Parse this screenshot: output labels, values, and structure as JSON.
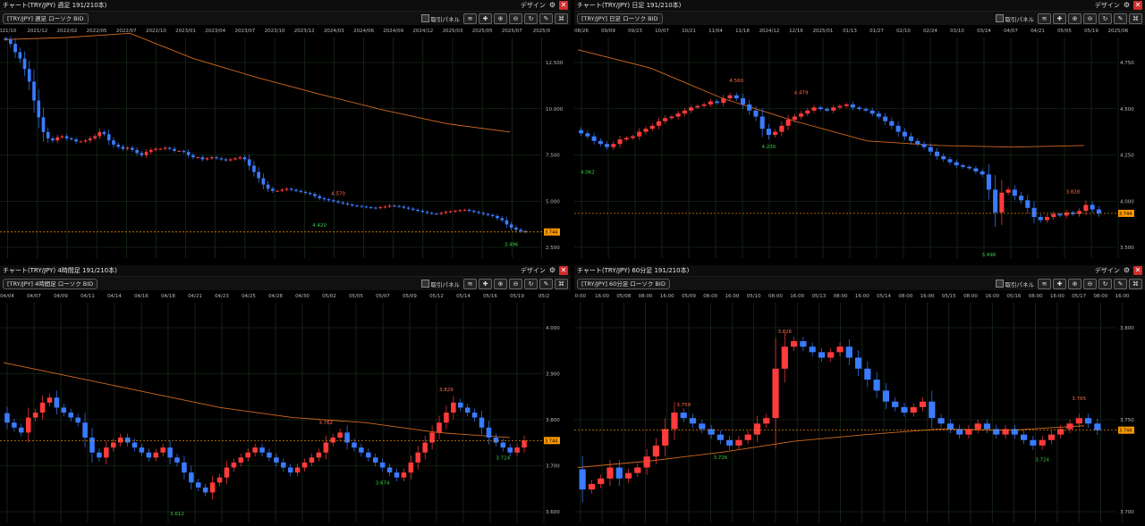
{
  "common": {
    "design_label": "デザイン",
    "trade_panel_label": "取引パネル",
    "symbol_select": "[TRY/JPY] ローソク BID",
    "colors": {
      "up": "#ff3b3b",
      "down": "#3a7bff",
      "ma": "#d2691e",
      "grid": "#1f3a1f",
      "axis": "#bbbbbb",
      "current": "#ff9900"
    }
  },
  "panels": [
    {
      "title": "チャート(TRY/JPY) 週足 191/210本)",
      "symbol": "[TRY/JPY] 週足 ローソク BID",
      "x_ticks": [
        "021/10",
        "2021/12",
        "2022/02",
        "2022/05",
        "2022/07",
        "2022/10",
        "2023/01",
        "2023/04",
        "2023/07",
        "2023/10",
        "2023/12",
        "2024/03",
        "2024/06",
        "2024/09",
        "2024/12",
        "2025/03",
        "2025/05",
        "2025/07",
        "2025/0"
      ],
      "y_ticks": [
        "12.500",
        "10.000",
        "7.500",
        "5.000",
        "2.500"
      ],
      "current_price": "3.744",
      "annotations": [
        "4.420",
        "4.570",
        "3.496"
      ]
    },
    {
      "title": "チャート(TRY/JPY) 日足 191/210本)",
      "symbol": "[TRY/JPY] 日足 ローソク BID",
      "x_ticks": [
        "08/26",
        "09/09",
        "09/23",
        "10/07",
        "10/21",
        "11/04",
        "11/18",
        "2024/12",
        "12/16",
        "2025/01",
        "01/13",
        "01/27",
        "02/10",
        "02/24",
        "03/10",
        "03/24",
        "04/07",
        "04/21",
        "05/05",
        "05/19",
        "2025/06"
      ],
      "y_ticks": [
        "4.750",
        "4.500",
        "4.250",
        "4.000",
        "3.500"
      ],
      "current_price": "3.744",
      "annotations": [
        "4.560",
        "4.479",
        "4.230",
        "4.062",
        "3.496",
        "3.828"
      ]
    },
    {
      "title": "チャート(TRY/JPY) 4時間足 191/210本)",
      "symbol": "[TRY/JPY] 4時間足 ローソク BID",
      "x_ticks": [
        "04/04",
        "04/07",
        "04/09",
        "04/11",
        "04/14",
        "04/16",
        "04/18",
        "04/21",
        "04/23",
        "04/25",
        "04/28",
        "04/30",
        "05/02",
        "05/05",
        "05/07",
        "05/09",
        "05/12",
        "05/14",
        "05/16",
        "05/19",
        "05/2"
      ],
      "y_ticks": [
        "4.000",
        "3.900",
        "3.800",
        "3.700",
        "3.600"
      ],
      "current_price": "3.744",
      "annotations": [
        "3.829",
        "3.762",
        "3.674",
        "3.724",
        "3.612"
      ]
    },
    {
      "title": "チャート(TRY/JPY) 60分足 191/210本)",
      "symbol": "[TRY/JPY] 60分足 ローソク BID",
      "x_ticks": [
        "0:00",
        "16:00",
        "05/08",
        "08:00",
        "16:00",
        "05/09",
        "08:00",
        "16:00",
        "05/10",
        "08:00",
        "16:00",
        "05/13",
        "08:00",
        "16:00",
        "05/14",
        "08:00",
        "16:00",
        "05/15",
        "08:00",
        "16:00",
        "05/16",
        "08:00",
        "16:00",
        "05/17",
        "08:00",
        "16:00"
      ],
      "y_ticks": [
        "3.800",
        "3.750",
        "3.700"
      ],
      "current_price": "3.744",
      "annotations": [
        "3.826",
        "3.759",
        "3.726",
        "3.724",
        "3.765"
      ]
    }
  ],
  "chart_data": [
    {
      "type": "candlestick",
      "timeframe": "weekly",
      "ylim": [
        2.5,
        13
      ],
      "close": [
        12.9,
        12.7,
        12.3,
        12.0,
        11.5,
        10.9,
        10.0,
        9.2,
        8.5,
        8.2,
        8.1,
        8.25,
        8.3,
        8.2,
        8.15,
        8.05,
        8.05,
        8.1,
        8.2,
        8.3,
        8.5,
        8.4,
        8.1,
        7.9,
        7.8,
        7.7,
        7.75,
        7.65,
        7.5,
        7.4,
        7.55,
        7.65,
        7.7,
        7.7,
        7.75,
        7.7,
        7.6,
        7.6,
        7.55,
        7.4,
        7.3,
        7.3,
        7.2,
        7.25,
        7.3,
        7.25,
        7.2,
        7.15,
        7.2,
        7.25,
        7.3,
        7.2,
        6.9,
        6.6,
        6.3,
        6.0,
        5.8,
        5.7,
        5.7,
        5.75,
        5.8,
        5.75,
        5.7,
        5.65,
        5.6,
        5.55,
        5.45,
        5.35,
        5.3,
        5.25,
        5.2,
        5.15,
        5.1,
        5.05,
        5.0,
        4.98,
        4.95,
        4.92,
        4.9,
        4.88,
        4.92,
        4.95,
        5.0,
        4.98,
        4.95,
        4.9,
        4.85,
        4.8,
        4.75,
        4.7,
        4.65,
        4.62,
        4.6,
        4.65,
        4.7,
        4.72,
        4.75,
        4.78,
        4.8,
        4.75,
        4.7,
        4.65,
        4.6,
        4.55,
        4.5,
        4.4,
        4.3,
        4.1,
        3.95,
        3.85,
        3.78,
        3.74
      ],
      "ma": [
        [
          12.9,
          8.7
        ],
        [
          13.0,
          10.5
        ],
        [
          13.2,
          11.2
        ],
        [
          12.0,
          12.7
        ],
        [
          11.1,
          13.8
        ],
        [
          10.3,
          14.7
        ],
        [
          9.55,
          15.4
        ],
        [
          8.9,
          15.9
        ],
        [
          8.5,
          16.1
        ]
      ]
    },
    {
      "type": "candlestick",
      "timeframe": "daily",
      "ylim": [
        3.45,
        4.9
      ],
      "close": [
        4.27,
        4.25,
        4.22,
        4.2,
        4.18,
        4.2,
        4.23,
        4.24,
        4.25,
        4.28,
        4.3,
        4.32,
        4.35,
        4.37,
        4.38,
        4.4,
        4.42,
        4.44,
        4.45,
        4.46,
        4.48,
        4.47,
        4.5,
        4.52,
        4.5,
        4.46,
        4.42,
        4.38,
        4.3,
        4.26,
        4.28,
        4.32,
        4.36,
        4.38,
        4.4,
        4.42,
        4.44,
        4.43,
        4.42,
        4.44,
        4.45,
        4.46,
        4.44,
        4.43,
        4.42,
        4.4,
        4.38,
        4.35,
        4.32,
        4.28,
        4.25,
        4.22,
        4.2,
        4.18,
        4.15,
        4.12,
        4.1,
        4.08,
        4.06,
        4.05,
        4.04,
        4.02,
        4.0,
        3.9,
        3.75,
        3.88,
        3.9,
        3.86,
        3.83,
        3.78,
        3.72,
        3.7,
        3.72,
        3.74,
        3.73,
        3.75,
        3.74,
        3.76,
        3.8,
        3.77,
        3.744
      ],
      "ma": [
        [
          4.82,
          4.57
        ],
        [
          4.7,
          4.55
        ],
        [
          4.5,
          4.5
        ],
        [
          4.35,
          4.45
        ],
        [
          4.22,
          4.4
        ],
        [
          4.19,
          4.35
        ],
        [
          4.18,
          4.25
        ],
        [
          4.19,
          4.19
        ]
      ]
    },
    {
      "type": "candlestick",
      "timeframe": "4h",
      "ylim": [
        3.58,
        4.02
      ],
      "close": [
        3.78,
        3.77,
        3.76,
        3.79,
        3.8,
        3.82,
        3.83,
        3.81,
        3.8,
        3.79,
        3.78,
        3.75,
        3.72,
        3.71,
        3.73,
        3.74,
        3.75,
        3.74,
        3.73,
        3.72,
        3.71,
        3.72,
        3.73,
        3.71,
        3.7,
        3.68,
        3.66,
        3.65,
        3.64,
        3.66,
        3.67,
        3.69,
        3.7,
        3.71,
        3.72,
        3.73,
        3.72,
        3.71,
        3.7,
        3.69,
        3.68,
        3.69,
        3.7,
        3.71,
        3.72,
        3.74,
        3.75,
        3.76,
        3.74,
        3.73,
        3.72,
        3.71,
        3.7,
        3.69,
        3.68,
        3.67,
        3.68,
        3.7,
        3.72,
        3.74,
        3.76,
        3.78,
        3.8,
        3.82,
        3.81,
        3.8,
        3.79,
        3.77,
        3.75,
        3.74,
        3.73,
        3.72,
        3.73,
        3.744
      ],
      "ma": [
        [
          3.9,
          3.844
        ],
        [
          3.87,
          3.826
        ],
        [
          3.84,
          3.809
        ],
        [
          3.81,
          3.796
        ],
        [
          3.79,
          3.789
        ],
        [
          3.78,
          3.775
        ],
        [
          3.76,
          3.758
        ],
        [
          3.75,
          3.744
        ]
      ]
    },
    {
      "type": "candlestick",
      "timeframe": "60m",
      "ylim": [
        3.66,
        3.86
      ],
      "close": [
        3.69,
        3.695,
        3.7,
        3.71,
        3.7,
        3.705,
        3.71,
        3.72,
        3.73,
        3.745,
        3.76,
        3.755,
        3.75,
        3.745,
        3.74,
        3.735,
        3.73,
        3.735,
        3.74,
        3.75,
        3.755,
        3.8,
        3.82,
        3.825,
        3.82,
        3.815,
        3.81,
        3.815,
        3.82,
        3.81,
        3.8,
        3.79,
        3.78,
        3.77,
        3.765,
        3.76,
        3.765,
        3.77,
        3.755,
        3.75,
        3.745,
        3.74,
        3.745,
        3.75,
        3.745,
        3.74,
        3.745,
        3.74,
        3.735,
        3.73,
        3.735,
        3.74,
        3.745,
        3.75,
        3.755,
        3.75,
        3.744
      ],
      "ma": [
        [
          3.71,
          3.708
        ],
        [
          3.716,
          3.705
        ],
        [
          3.724,
          3.705
        ],
        [
          3.734,
          3.713
        ],
        [
          3.74,
          3.725
        ],
        [
          3.745,
          3.735
        ],
        [
          3.744,
          3.742
        ],
        [
          3.748,
          3.746
        ]
      ]
    }
  ]
}
